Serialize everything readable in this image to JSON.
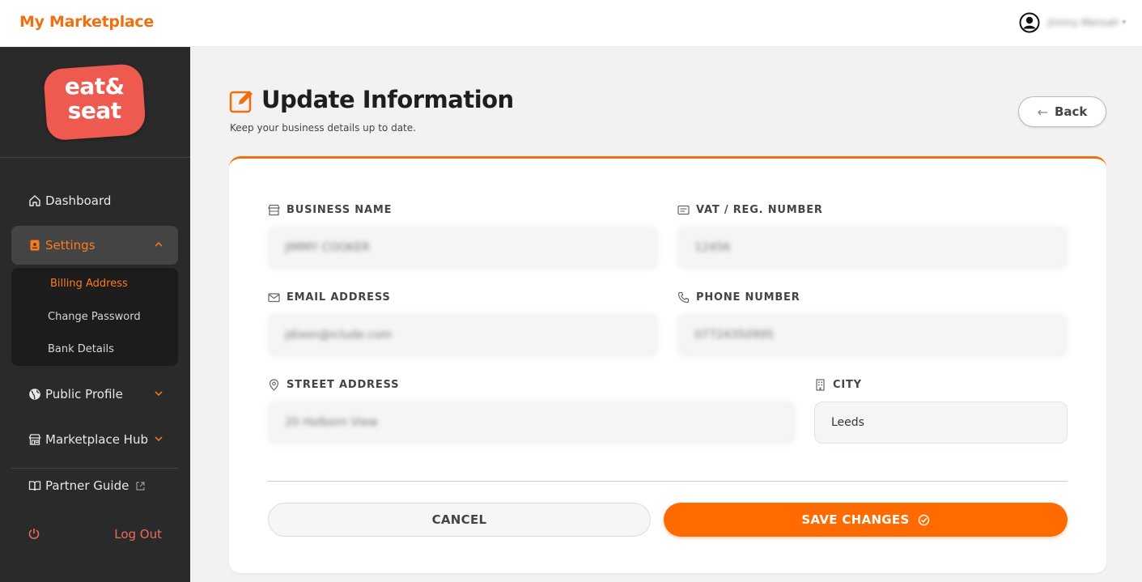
{
  "topbar": {
    "brand": "My Marketplace",
    "user_name": "Jimmy Mensah",
    "user_caret": "▾"
  },
  "sidebar": {
    "logo_line1": "eat&",
    "logo_line2": "seat",
    "nav": {
      "dashboard": "Dashboard",
      "settings": "Settings",
      "public_profile": "Public Profile",
      "marketplace_hub": "Marketplace Hub",
      "partner_guide": "Partner Guide",
      "log_out": "Log Out"
    },
    "settings_sub": {
      "billing_address": "Billing Address",
      "change_password": "Change Password",
      "bank_details": "Bank Details"
    }
  },
  "main": {
    "title": "Update Information",
    "subtitle": "Keep your business details up to date.",
    "back_label": "Back",
    "back_arrow": "←"
  },
  "form": {
    "business_name": {
      "label": "BUSINESS NAME",
      "value": "JIMMY COOKER"
    },
    "vat": {
      "label": "VAT / REG. NUMBER",
      "value": "12456"
    },
    "email": {
      "label": "EMAIL ADDRESS",
      "value": "jdixon@iclude.com"
    },
    "phone": {
      "label": "PHONE NUMBER",
      "value": "07724350995"
    },
    "street": {
      "label": "STREET ADDRESS",
      "value": "20 Holborn View"
    },
    "city": {
      "label": "CITY",
      "value": "Leeds"
    },
    "cancel_label": "CANCEL",
    "save_label": "SAVE CHANGES"
  },
  "colors": {
    "accent": "#ff6b00",
    "brand": "#f07010",
    "sidebar_bg": "#2a2a2a",
    "logo": "#ee5a4f",
    "logout": "#f06a5a"
  }
}
